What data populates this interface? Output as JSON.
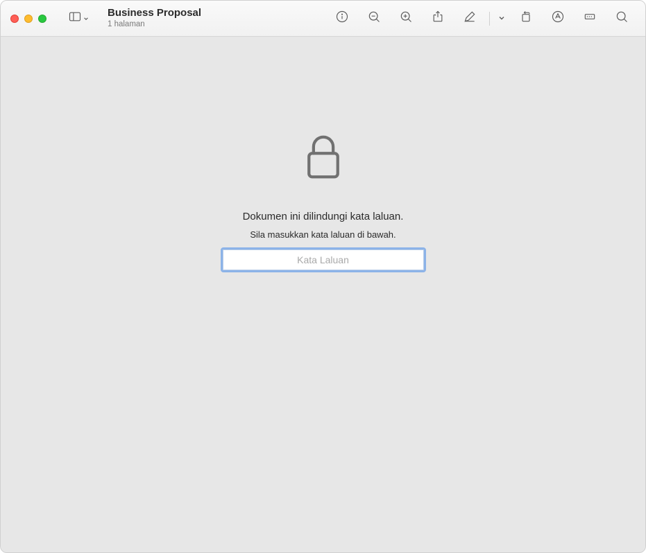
{
  "document": {
    "title": "Business Proposal",
    "subtitle": "1 halaman"
  },
  "toolbar": {
    "sidebar_icon": "sidebar-icon",
    "info_icon": "info-icon",
    "zoom_out_icon": "zoom-out-icon",
    "zoom_in_icon": "zoom-in-icon",
    "share_icon": "share-icon",
    "markup_icon": "markup-icon",
    "rotate_icon": "rotate-icon",
    "highlight_icon": "highlight-icon",
    "crop_icon": "crop-icon",
    "search_icon": "search-icon"
  },
  "lock": {
    "protected_message": "Dokumen ini dilindungi kata laluan.",
    "instruction_message": "Sila masukkan kata laluan di bawah.",
    "password_placeholder": "Kata Laluan"
  }
}
